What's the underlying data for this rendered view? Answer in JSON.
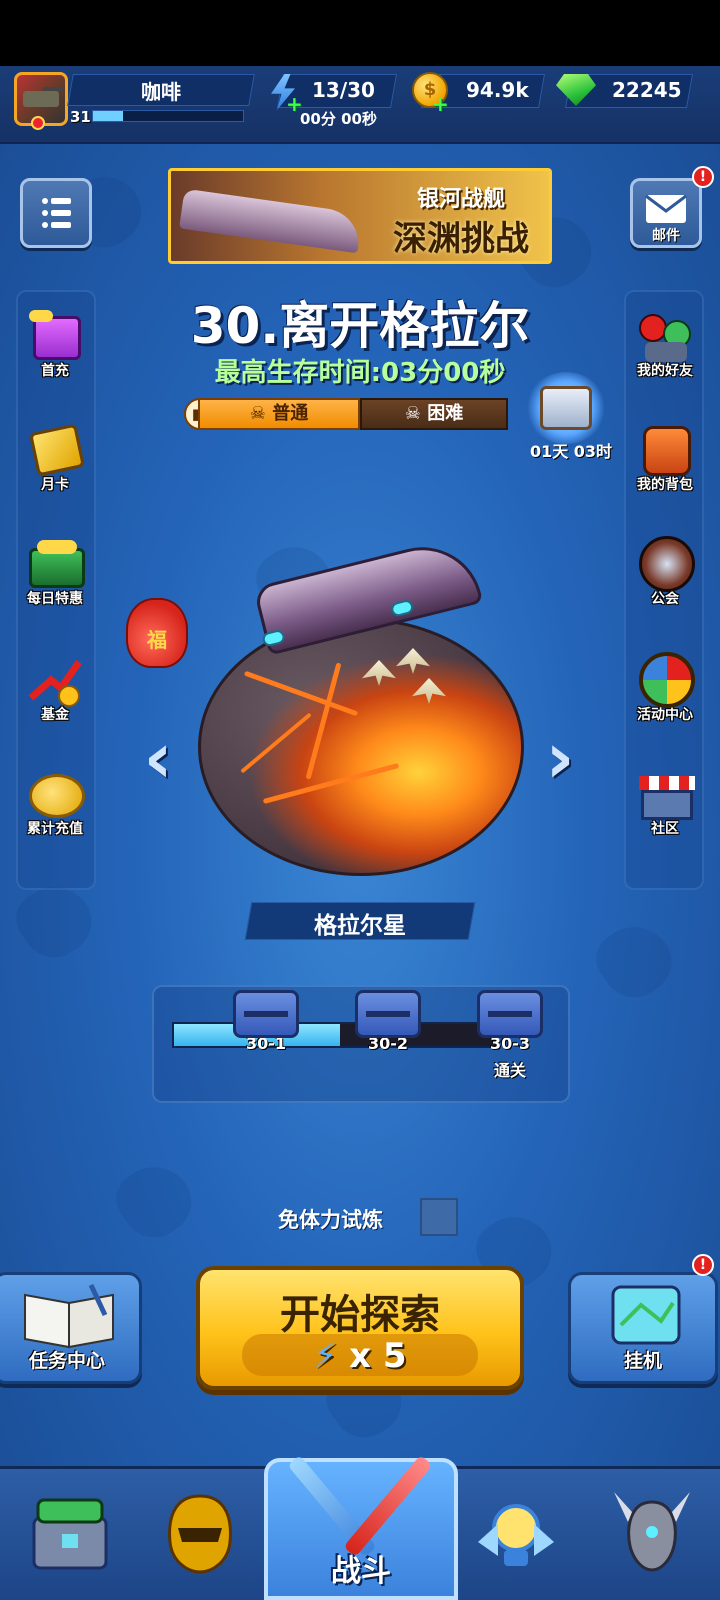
{
  "player": {
    "name": "咖啡",
    "level": "31",
    "xp_fraction": 0.2
  },
  "resources": {
    "energy": "13/30",
    "energy_timer": "00分 00秒",
    "coins": "94.9k",
    "gems": "22245",
    "coin_symbol": "$"
  },
  "banner": {
    "line1": "银河战舰",
    "line2": "深渊挑战"
  },
  "stage": {
    "title": "30.离开格拉尔",
    "best_survival": "最高生存时间:03分00秒",
    "difficulty_normal": "普通",
    "difficulty_hard": "困难",
    "planet_name": "格拉尔星",
    "progress_fraction": 0.52
  },
  "chest_timer": "01天 03时",
  "lucky_bag_text": "福",
  "left_menu": [
    {
      "label": "首充",
      "icon": "gift-icon"
    },
    {
      "label": "月卡",
      "icon": "card-icon"
    },
    {
      "label": "每日特惠",
      "icon": "treasure-chest-icon"
    },
    {
      "label": "基金",
      "icon": "fund-arrow-icon"
    },
    {
      "label": "累计充值",
      "icon": "piggy-bank-icon"
    }
  ],
  "right_menu": [
    {
      "label": "邮件",
      "icon": "mail-icon"
    },
    {
      "label": "我的好友",
      "icon": "friends-icon"
    },
    {
      "label": "我的背包",
      "icon": "backpack-icon"
    },
    {
      "label": "公会",
      "icon": "guild-icon"
    },
    {
      "label": "活动中心",
      "icon": "event-wheel-icon"
    },
    {
      "label": "社区",
      "icon": "shop-icon"
    }
  ],
  "nodes": [
    {
      "label": "30-1",
      "sub": ""
    },
    {
      "label": "30-2",
      "sub": ""
    },
    {
      "label": "30-3",
      "sub": "通关"
    }
  ],
  "free_trial": "免体力试炼",
  "actions": {
    "tasks": "任务中心",
    "idle": "挂机",
    "start": "开始探索",
    "start_cost": "x 5",
    "badge": "!"
  },
  "nav": {
    "battle": "战斗"
  },
  "colors": {
    "accent": "#ffc21a",
    "panel": "#0f2f66",
    "energy": "#2c7fe0",
    "gem": "#29c13a"
  }
}
